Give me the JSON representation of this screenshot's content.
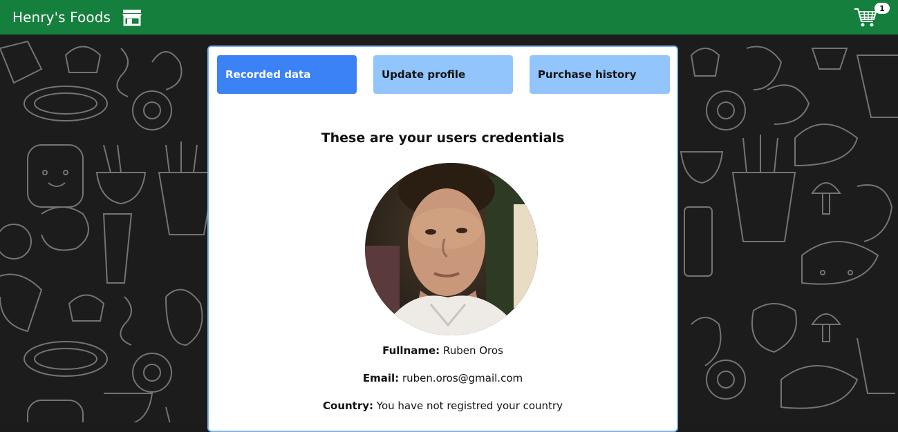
{
  "header": {
    "brand": "Henry's Foods",
    "brand_icon": "store-icon",
    "cart_icon": "shopping-cart-icon",
    "cart_count": "1",
    "color": "#15803d"
  },
  "tabs": [
    {
      "label": "Recorded data",
      "active": true
    },
    {
      "label": "Update profile",
      "active": false
    },
    {
      "label": "Purchase history",
      "active": false
    }
  ],
  "profile": {
    "heading": "These are your users credentials",
    "fields": [
      {
        "label": "Fullname:",
        "value": "Ruben Oros"
      },
      {
        "label": "Email:",
        "value": "ruben.oros@gmail.com"
      },
      {
        "label": "Country:",
        "value": "You have not registred your country"
      }
    ]
  },
  "colors": {
    "active_tab": "#3b82f6",
    "inactive_tab": "#93c5fd",
    "card_border": "#7fb5ea"
  }
}
